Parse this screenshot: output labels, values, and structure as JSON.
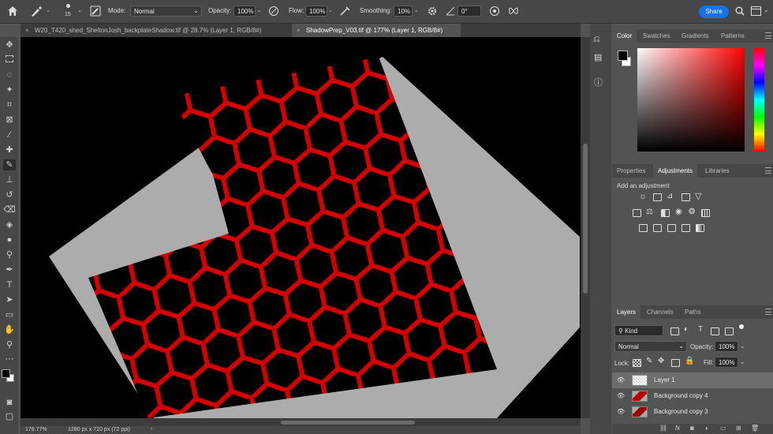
{
  "options_bar": {
    "brush_size": "15",
    "mode_label": "Mode:",
    "mode_value": "Normal",
    "opacity_label": "Opacity:",
    "opacity_value": "100%",
    "flow_label": "Flow:",
    "flow_value": "100%",
    "smoothing_label": "Smoothing:",
    "smoothing_value": "10%",
    "angle_value": "0°",
    "share_label": "Share"
  },
  "document_tabs": [
    {
      "title": "W20_T420_shed_SheltonJosh_backplateShadow.tif @ 28.7% (Layer 1, RGB/8#)",
      "active": false
    },
    {
      "title": "ShadowPrep_V03.tif @ 177% (Layer 1, RGB/8#)",
      "active": true
    }
  ],
  "color_panel": {
    "tabs": [
      "Color",
      "Swatches",
      "Gradients",
      "Patterns"
    ],
    "active_tab": "Color",
    "hue_color": "#ff0000"
  },
  "adjustments_panel": {
    "tabs": [
      "Properties",
      "Adjustments",
      "Libraries"
    ],
    "active_tab": "Adjustments",
    "add_label": "Add an adjustment"
  },
  "layers_panel": {
    "tabs": [
      "Layers",
      "Channels",
      "Paths"
    ],
    "active_tab": "Layers",
    "filter_value": "Kind",
    "blend_mode": "Normal",
    "opacity_label": "Opacity:",
    "opacity_value": "100%",
    "lock_label": "Lock:",
    "fill_label": "Fill:",
    "fill_value": "100%",
    "layers": [
      {
        "name": "Layer 1",
        "selected": true
      },
      {
        "name": "Background copy 4",
        "selected": false
      },
      {
        "name": "Background copy 3",
        "selected": false
      }
    ]
  },
  "status_bar": {
    "zoom": "176.77%",
    "doc_info": "1280 px x 720 px (72 ppi)"
  },
  "colors": {
    "pattern_red": "#d40000",
    "backplate_gray": "#acacac",
    "accent": "#1473e6"
  }
}
